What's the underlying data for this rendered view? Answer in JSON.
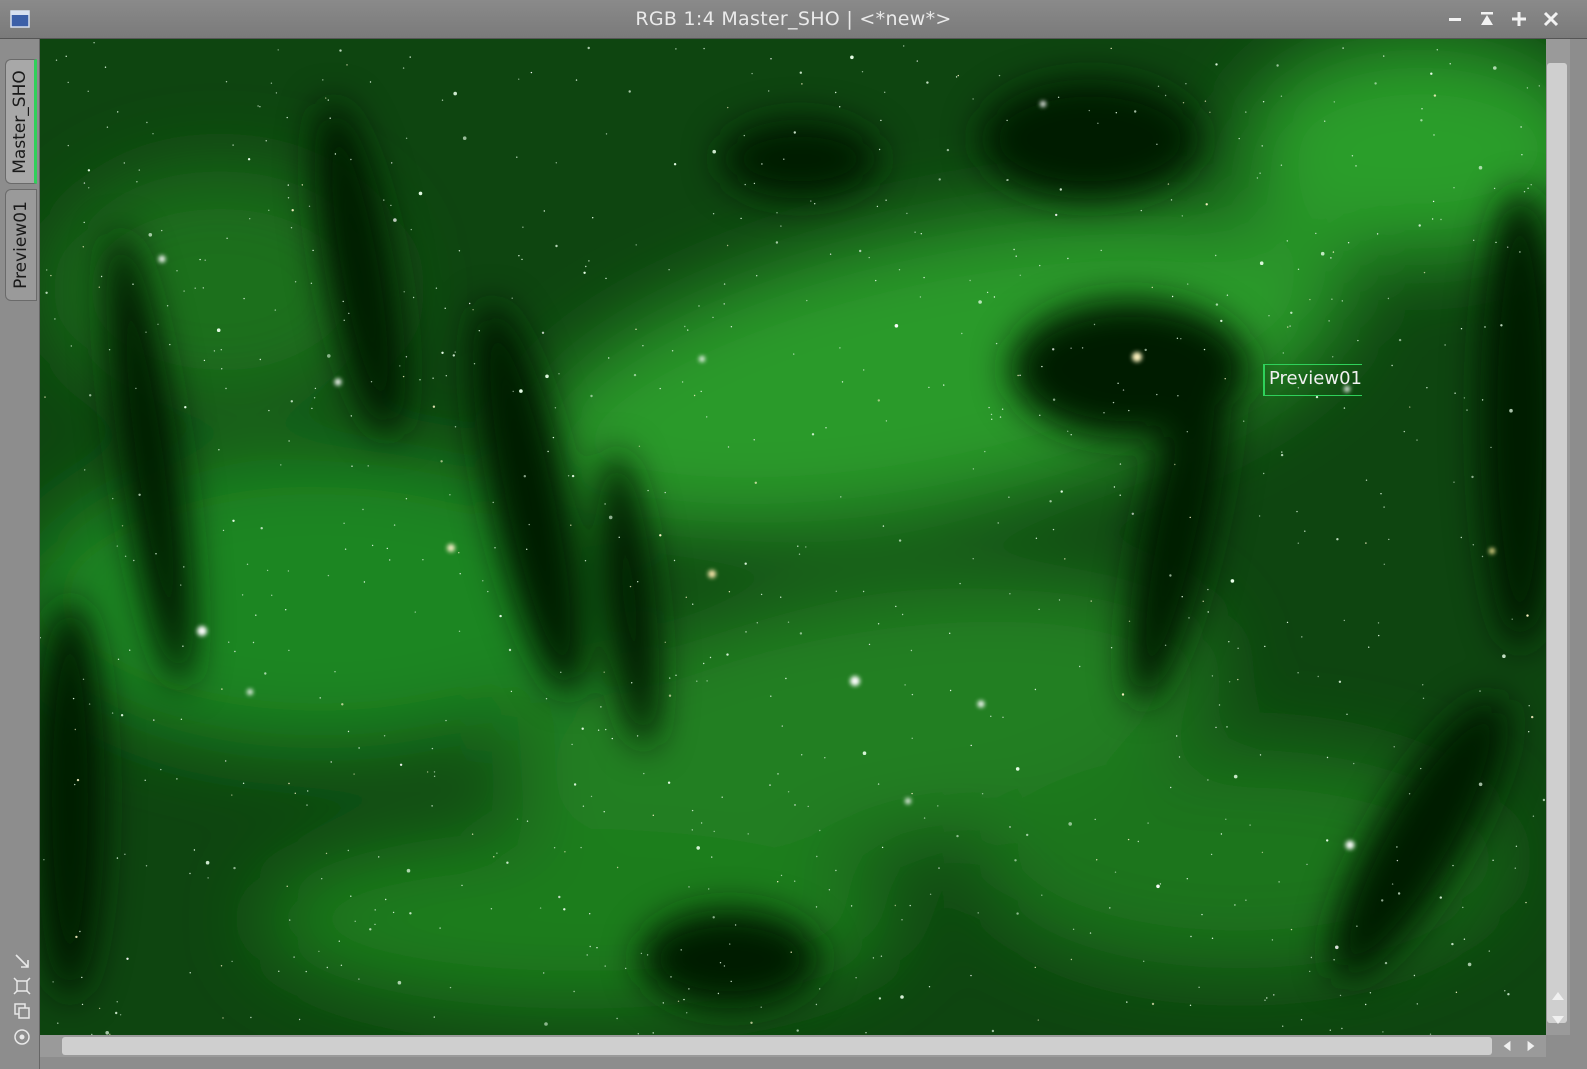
{
  "window": {
    "title": "RGB 1:4 Master_SHO | <*new*>",
    "buttons": [
      "minimize",
      "shade",
      "maximize",
      "close"
    ]
  },
  "tabs": [
    {
      "label": "Master_SHO",
      "active": true
    },
    {
      "label": "Preview01",
      "active": false
    }
  ],
  "preview": {
    "label": "Preview01",
    "border_color": "#2fd15a"
  },
  "colors": {
    "nebula": "#1f8a1f",
    "accent": "#2fd15a"
  }
}
